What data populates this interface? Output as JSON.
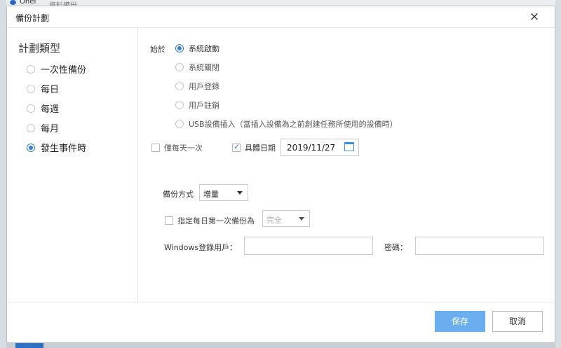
{
  "background": {
    "app_title": "Onef",
    "app_title2": "資料備份"
  },
  "dialog": {
    "title": "備份計劃",
    "close_symbol": "×"
  },
  "plan_type": {
    "heading": "計劃類型",
    "options": [
      {
        "label": "一次性備份",
        "checked": false
      },
      {
        "label": "每日",
        "checked": false
      },
      {
        "label": "每週",
        "checked": false
      },
      {
        "label": "每月",
        "checked": false
      },
      {
        "label": "發生事件時",
        "checked": true
      }
    ]
  },
  "trigger": {
    "label": "始於",
    "options": [
      {
        "label": "系統啟動",
        "checked": true
      },
      {
        "label": "系統關閉",
        "checked": false
      },
      {
        "label": "用戶登錄",
        "checked": false
      },
      {
        "label": "用戶註銷",
        "checked": false
      },
      {
        "label": "USB設備插入（當插入設備為之前創建任務所使用的設備時）",
        "checked": false
      }
    ]
  },
  "once_per_day": {
    "label": "僅每天一次",
    "checked": false
  },
  "specific_date": {
    "label": "具體日期",
    "checked": true,
    "value": "2019/11/27"
  },
  "backup_mode": {
    "label": "備份方式",
    "value": "增量"
  },
  "first_backup": {
    "label": "指定每日第一次備份為",
    "checked": false,
    "value": "完全"
  },
  "windows_user": {
    "label": "Windows登錄用戶：",
    "value": ""
  },
  "password": {
    "label": "密碼：",
    "value": ""
  },
  "footer": {
    "save_label": "保存",
    "cancel_label": "取消"
  },
  "colors": {
    "accent": "#2f7fd8",
    "save_button": "#6aaef0"
  },
  "icons": {
    "close": "close-icon",
    "calendar": "calendar-icon",
    "dropdown": "chevron-down-icon"
  }
}
